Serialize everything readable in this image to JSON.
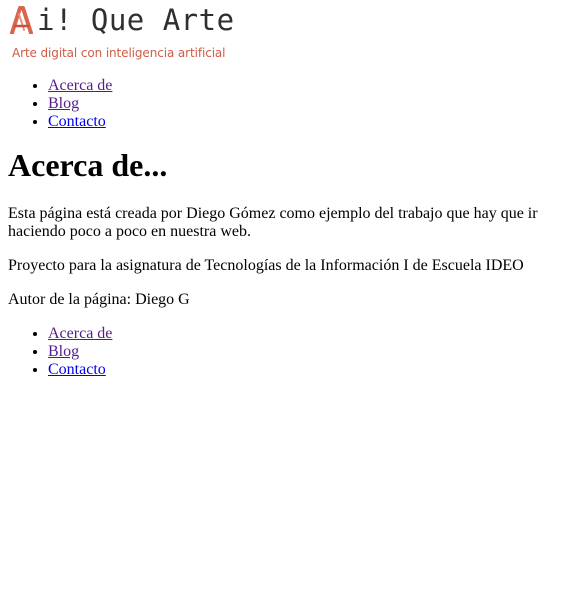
{
  "logo": {
    "title": "i! Que Arte",
    "subtitle": "Arte digital con inteligencia artificial",
    "brand_color": "#cf5c46"
  },
  "nav": {
    "items": [
      {
        "label": "Acerca de"
      },
      {
        "label": "Blog"
      },
      {
        "label": "Contacto"
      }
    ]
  },
  "main": {
    "heading": "Acerca de...",
    "paragraphs": [
      "Esta página está creada por Diego Gómez como ejemplo del trabajo que hay que ir haciendo poco a poco en nuestra web.",
      "Proyecto para la asignatura de Tecnologías de la Información I de Escuela IDEO",
      "Autor de la página: Diego G"
    ]
  },
  "footer_nav": {
    "items": [
      {
        "label": "Acerca de"
      },
      {
        "label": "Blog"
      },
      {
        "label": "Contacto"
      }
    ]
  }
}
